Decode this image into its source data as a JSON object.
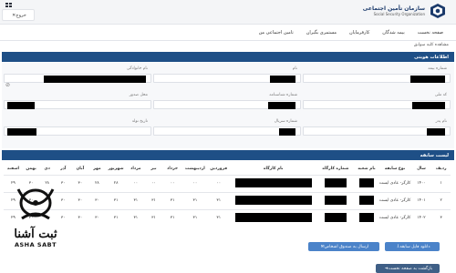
{
  "header": {
    "org_name_fa": "سازمان تأمین اجتماعی",
    "org_name_en": "Social Security Organization",
    "exit_label": "خروج",
    "exit_icon": "close-icon"
  },
  "nav": {
    "items": [
      {
        "label": "صفحه نخست"
      },
      {
        "label": "بیمه شدگان"
      },
      {
        "label": "کارفرمایان"
      },
      {
        "label": "مستمری بگیران"
      },
      {
        "label": "تامین اجتماعی من"
      }
    ]
  },
  "breadcrumb": "مشاهده کلیه سوابق",
  "identity_section": {
    "title": "اطلاعات هویتی",
    "fields": [
      {
        "label": "شماره بیمه"
      },
      {
        "label": "نام"
      },
      {
        "label": "نام خانوادگی"
      },
      {
        "label": "کد ملی"
      },
      {
        "label": "شماره شناسنامه"
      },
      {
        "label": "محل صدور"
      },
      {
        "label": "نام پدر"
      },
      {
        "label": "شماره سریال"
      },
      {
        "label": "تاریخ تولد"
      }
    ]
  },
  "history_section": {
    "title": "لیست سابقه",
    "columns": [
      "ردیف",
      "سال",
      "نوع سابقه",
      "نام شعبه",
      "شماره کارگاه",
      "نام کارگاه",
      "فروردین",
      "اردیبهشت",
      "خرداد",
      "تیر",
      "مرداد",
      "شهریور",
      "مهر",
      "آبان",
      "آذر",
      "دی",
      "بهمن",
      "اسفند"
    ],
    "rows": [
      {
        "index": "۱",
        "year": "۱۴۰۰",
        "type": "کارگر- عادی ایست",
        "months": [
          "۰۰",
          "۰۰",
          "۰۰",
          "۰۰",
          "۰۰",
          "۲۸",
          "۲۸",
          "۳۰",
          "۳۰",
          "۲۸",
          "۳۰",
          "۲۹"
        ]
      },
      {
        "index": "۲",
        "year": "۱۴۰۱",
        "type": "کارگر- عادی ایست",
        "months": [
          "۳۱",
          "۳۱",
          "۳۱",
          "۳۱",
          "۳۱",
          "۳۱",
          "۳۰",
          "۳۰",
          "۳۰",
          "۳۰",
          "۳۰",
          "۲۹"
        ]
      },
      {
        "index": "۳",
        "year": "۱۴۰۲",
        "type": "کارگر- عادی ایست",
        "months": [
          "۳۱",
          "۳۱",
          "۳۱",
          "۳۱",
          "۳۱",
          "۳۱",
          "۳۰",
          "۳۰",
          "۳۰",
          "۳۰",
          "۳۰",
          "۲۹"
        ]
      }
    ],
    "print_button": "دانلود فایل سابقه",
    "send_button": "ارسال به صندوق اشخاص",
    "back_button": "بازگشت به صفحه نخست"
  },
  "watermark": {
    "text_fa": "ثبت آشنا",
    "text_en": "ASHA SABT"
  },
  "colors": {
    "section_bar": "#1e4f86",
    "button_primary": "#4b83c9",
    "button_back": "#3f5f86"
  }
}
